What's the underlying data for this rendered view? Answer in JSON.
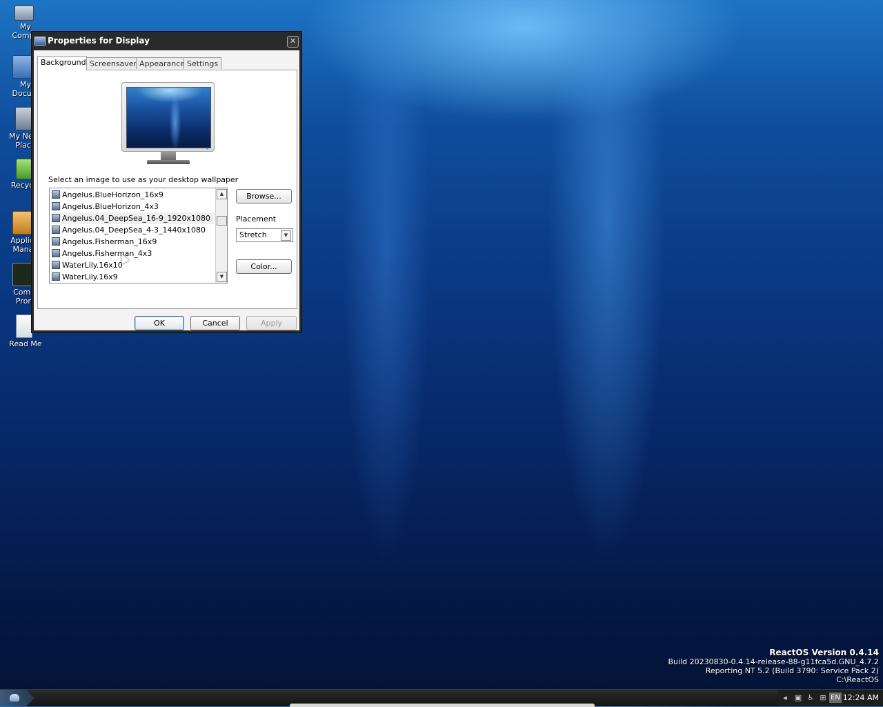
{
  "desktop": {
    "icons": [
      {
        "label": "My\nCompu",
        "icon": "computer-icon"
      },
      {
        "label": "My\nDocum",
        "icon": "folder-documents-icon"
      },
      {
        "label": "My Netw\nPlace",
        "icon": "network-places-icon"
      },
      {
        "label": "Recycle",
        "icon": "recycle-bin-icon"
      },
      {
        "label": "Applical\nManag",
        "icon": "applications-manager-icon"
      },
      {
        "label": "Comm\nProm",
        "icon": "command-prompt-icon"
      },
      {
        "label": "Read Me",
        "icon": "document-icon"
      }
    ]
  },
  "dialog": {
    "title": "Properties for Display",
    "tabs": [
      {
        "label": "Background",
        "active": true
      },
      {
        "label": "Screensaver",
        "active": false
      },
      {
        "label": "Appearance",
        "active": false
      },
      {
        "label": "Settings",
        "active": false
      }
    ],
    "instruction": "Select an image to use as your desktop wallpaper",
    "wallpapers": [
      "Angelus.BlueHorizon_16x9",
      "Angelus.BlueHorizon_4x3",
      "Angelus.04_DeepSea_16-9_1920x1080",
      "Angelus.04_DeepSea_4-3_1440x1080",
      "Angelus.Fisherman_16x9",
      "Angelus.Fisherman_4x3",
      "WaterLily.16x10",
      "WaterLily.16x9"
    ],
    "selected_index": 2,
    "browse_label": "Browse...",
    "placement_label": "Placement",
    "placement_value": "Stretch",
    "color_label": "Color...",
    "ok_label": "OK",
    "cancel_label": "Cancel",
    "apply_label": "Apply"
  },
  "osinfo": {
    "version": "ReactOS Version 0.4.14",
    "build": "Build 20230830-0.4.14-release-88-g11fca5d.GNU_4.7.2",
    "reporting": "Reporting NT 5.2 (Build 3790: Service Pack 2)",
    "path": "C:\\ReactOS"
  },
  "taskbar": {
    "language": "EN",
    "clock": "12:24 AM"
  },
  "colors": {
    "titlebar": "#2a2a2a",
    "default_button_border": "#3a6ea5",
    "taskbar": "#151515"
  }
}
